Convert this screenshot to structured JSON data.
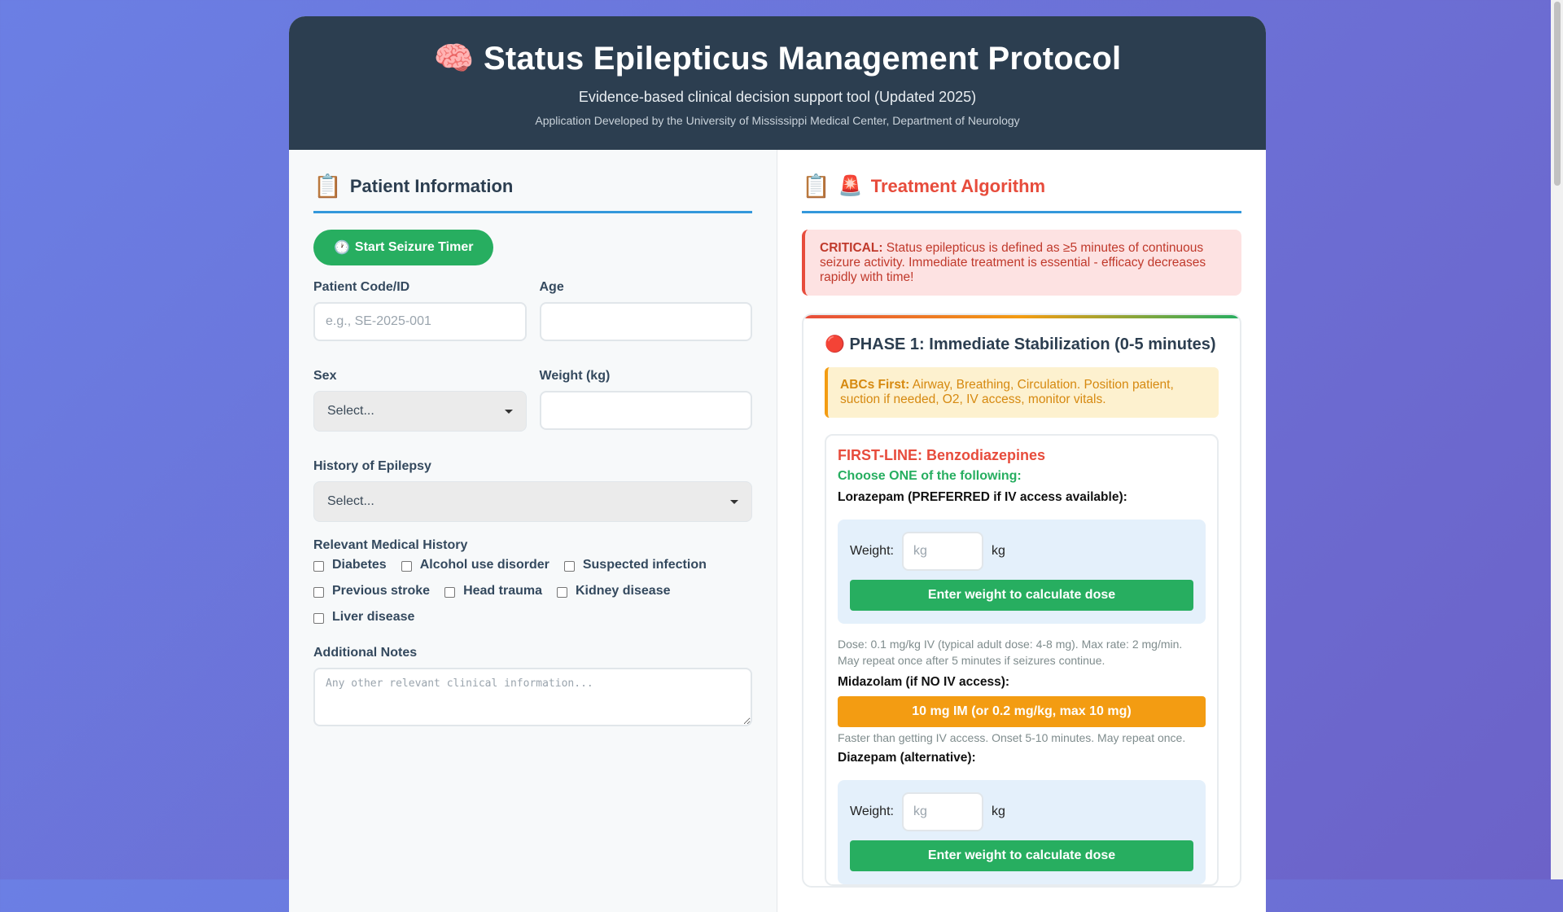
{
  "header": {
    "icon": "🧠",
    "title": "Status Epilepticus Management Protocol",
    "subtitle": "Evidence-based clinical decision support tool (Updated 2025)",
    "credit": "Application Developed by the University of Mississippi Medical Center, Department of Neurology"
  },
  "patient": {
    "section_icon": "📋",
    "section_title": "Patient Information",
    "timer_icon": "🕐",
    "timer_label": "Start Seizure Timer",
    "id_label": "Patient Code/ID",
    "id_placeholder": "e.g., SE-2025-001",
    "id_value": "",
    "age_label": "Age",
    "age_value": "",
    "sex_label": "Sex",
    "sex_value": "Select...",
    "weight_label": "Weight (kg)",
    "weight_value": "",
    "epilepsy_label": "History of Epilepsy",
    "epilepsy_value": "Select...",
    "history_label": "Relevant Medical History",
    "history": [
      "Diabetes",
      "Alcohol use disorder",
      "Suspected infection",
      "Previous stroke",
      "Head trauma",
      "Kidney disease",
      "Liver disease"
    ],
    "notes_label": "Additional Notes",
    "notes_placeholder": "Any other relevant clinical information..."
  },
  "treatment": {
    "section_icon": "📋",
    "section_icon2": "🚨",
    "section_title": "Treatment Algorithm",
    "critical_label": "CRITICAL:",
    "critical_text": " Status epilepticus is defined as ≥5 minutes of continuous seizure activity. Immediate treatment is essential - efficacy decreases rapidly with time!",
    "phase_icon": "🔴",
    "phase_title": "PHASE 1: Immediate Stabilization (0-5 minutes)",
    "abc_label": "ABCs First:",
    "abc_text": " Airway, Breathing, Circulation. Position patient, suction if needed, O2, IV access, monitor vitals.",
    "first_line": "FIRST-LINE: Benzodiazepines",
    "choose": "Choose ONE of the following:",
    "lorazepam_label": "Lorazepam (PREFERRED if IV access available):",
    "weight_text": "Weight:",
    "kg_placeholder": "kg",
    "kg_unit": "kg",
    "calc_button": "Enter weight to calculate dose",
    "lorazepam_note": "Dose: 0.1 mg/kg IV (typical adult dose: 4-8 mg). Max rate: 2 mg/min. May repeat once after 5 minutes if seizures continue.",
    "midazolam_label": "Midazolam (if NO IV access):",
    "midazolam_dose": "10 mg IM (or 0.2 mg/kg, max 10 mg)",
    "midazolam_note": "Faster than getting IV access. Onset 5-10 minutes. May repeat once.",
    "diazepam_label": "Diazepam (alternative):"
  },
  "colors": {
    "header_bg": "#2c3e50",
    "accent_blue": "#3498db",
    "green": "#27ae60",
    "red": "#e74c3c",
    "orange": "#f39c12"
  }
}
